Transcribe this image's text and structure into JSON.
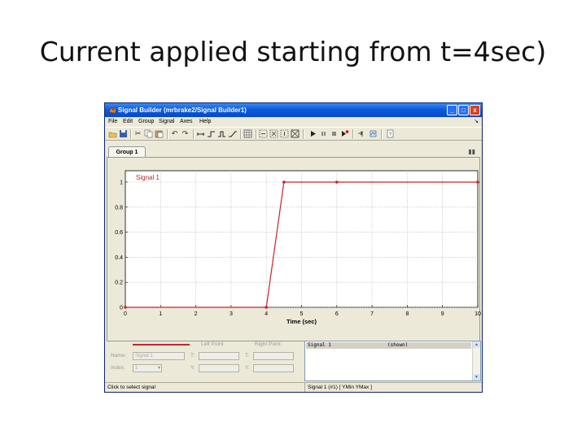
{
  "slide": {
    "title": "Current applied starting from t=4sec)"
  },
  "window": {
    "title": "Signal Builder (mrbrake2/Signal Builder1)",
    "controls": {
      "minimize": "_",
      "maximize": "□",
      "close": "x"
    }
  },
  "menu": {
    "items": [
      "File",
      "Edit",
      "Group",
      "Signal",
      "Axes",
      "Help"
    ],
    "dock": "↘"
  },
  "toolbar": {
    "icons": [
      "open-icon",
      "save-icon",
      "cut-icon",
      "copy-icon",
      "paste-icon",
      "undo-icon",
      "redo-icon",
      "insert-segment-icon",
      "step-icon",
      "pulse-icon",
      "ramp-icon",
      "grid-icon",
      "zoom-x-icon",
      "zoom-xy-icon",
      "zoom-y-icon",
      "fit-icon",
      "play-icon",
      "pause-icon",
      "stop-icon",
      "record-icon",
      "link-icon",
      "sim-icon",
      "help-icon"
    ]
  },
  "tab": {
    "label": "Group 1"
  },
  "chart_data": {
    "type": "line",
    "series": [
      {
        "name": "Signal 1",
        "x": [
          0,
          4,
          4.5,
          6,
          10
        ],
        "y": [
          0,
          0,
          1,
          1,
          1
        ],
        "color": "#c0272d"
      }
    ],
    "xlabel": "Time (sec)",
    "ylabel": "",
    "xlim": [
      0,
      10
    ],
    "ylim": [
      0,
      1
    ],
    "xticks": [
      "0",
      "1",
      "2",
      "3",
      "4",
      "5",
      "6",
      "7",
      "8",
      "9",
      "10"
    ],
    "yticks": [
      "0",
      "0.2",
      "0.4",
      "0.6",
      "0.8",
      "1"
    ],
    "grid": true
  },
  "properties": {
    "left_point": "Left Point",
    "right_point": "Right Point",
    "name_label": "Name:",
    "name_value": "Signal 1",
    "index_label": "Index:",
    "index_value": "1",
    "t_label": "T:",
    "y_label": "Y:"
  },
  "signal_list": {
    "row_name": "Signal 1",
    "row_status": "(shown)"
  },
  "status": {
    "left": "Click to select signal",
    "right": "Signal 1 (#1)  [ YMin YMax ]"
  }
}
